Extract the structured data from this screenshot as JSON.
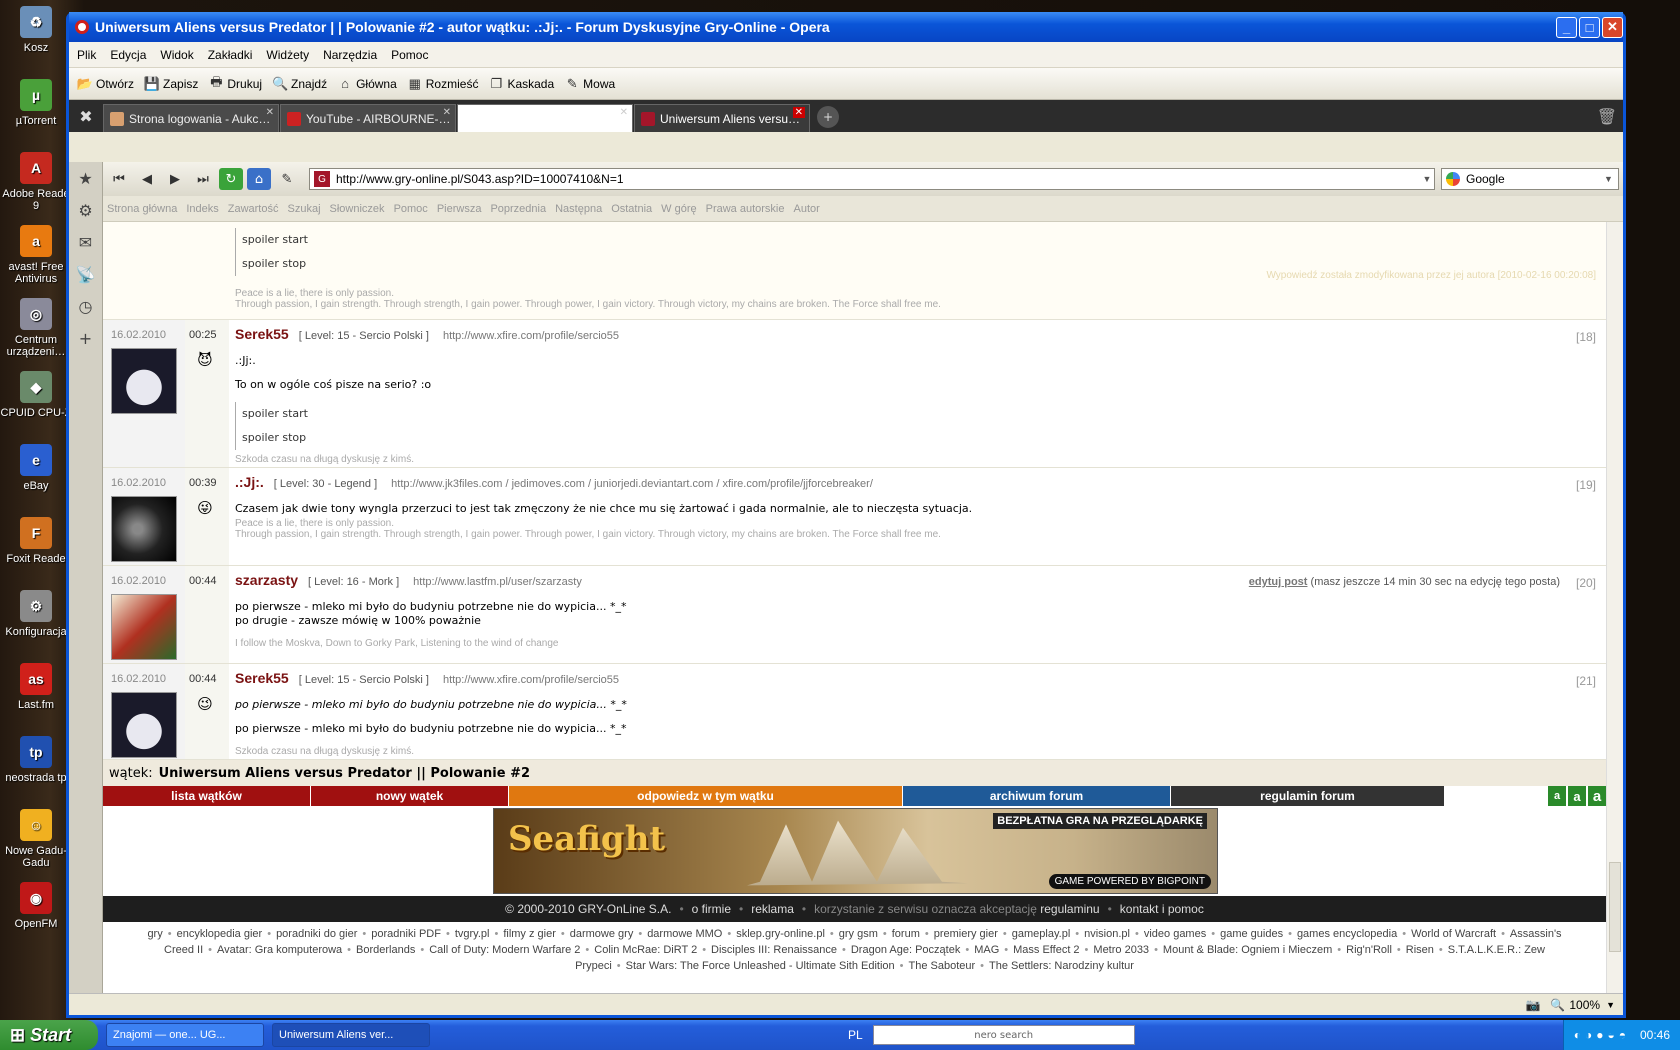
{
  "desktop": {
    "icons": [
      {
        "label": "Kosz",
        "color": "#6a8fb8",
        "glyph": "♻"
      },
      {
        "label": "µTorrent",
        "color": "#4aa03a",
        "glyph": "µ"
      },
      {
        "label": "Adobe Reade 9",
        "color": "#c5291f",
        "glyph": "A"
      },
      {
        "label": "avast! Free Antivirus",
        "color": "#e87a10",
        "glyph": "a"
      },
      {
        "label": "Centrum urządzeni…",
        "color": "#8a8a9a",
        "glyph": "◎"
      },
      {
        "label": "CPUID CPU-Z",
        "color": "#6a8a6a",
        "glyph": "◆"
      },
      {
        "label": "eBay",
        "color": "#2a5fd0",
        "glyph": "e"
      },
      {
        "label": "Foxit Reade",
        "color": "#d07020",
        "glyph": "F"
      },
      {
        "label": "Konfiguracja",
        "color": "#8a8a8a",
        "glyph": "⚙"
      },
      {
        "label": "Last.fm",
        "color": "#d0201a",
        "glyph": "as"
      },
      {
        "label": "neostrada tp",
        "color": "#2050b0",
        "glyph": "tp"
      },
      {
        "label": "Nowe Gadu-Gadu",
        "color": "#f0b020",
        "glyph": "☺"
      },
      {
        "label": "OpenFM",
        "color": "#c01818",
        "glyph": "◉"
      }
    ]
  },
  "window": {
    "title": "Uniwersum Aliens versus Predator | | Polowanie #2 - autor wątku: .:Jj:. - Forum Dyskusyjne Gry-Online - Opera"
  },
  "menu": [
    "Plik",
    "Edycja",
    "Widok",
    "Zakładki",
    "Widżety",
    "Narzędzia",
    "Pomoc"
  ],
  "toolbar": [
    {
      "label": "Otwórz",
      "icon": "folder-icon",
      "glyph": "📂"
    },
    {
      "label": "Zapisz",
      "icon": "save-icon",
      "glyph": "💾"
    },
    {
      "label": "Drukuj",
      "icon": "print-icon",
      "glyph": "🖶"
    },
    {
      "label": "Znajdź",
      "icon": "find-icon",
      "glyph": "🔍"
    },
    {
      "label": "Główna",
      "icon": "home-icon",
      "glyph": "⌂"
    },
    {
      "label": "Rozmieść",
      "icon": "tile-icon",
      "glyph": "▦"
    },
    {
      "label": "Kaskada",
      "icon": "cascade-icon",
      "glyph": "❐"
    },
    {
      "label": "Mowa",
      "icon": "speech-icon",
      "glyph": "✎"
    }
  ],
  "tabs": [
    {
      "label": "Strona logowania - Aukc…",
      "fav": "#d8a070",
      "blank": false,
      "active": false
    },
    {
      "label": "YouTube - AIRBOURNE-…",
      "fav": "#cc2222",
      "blank": false,
      "active": false
    },
    {
      "label": "",
      "fav": "#ffffff",
      "blank": true,
      "active": false
    },
    {
      "label": "Uniwersum Aliens versu…",
      "fav": "#a3162a",
      "blank": false,
      "active": true
    }
  ],
  "address": {
    "url": "http://www.gry-online.pl/S043.asp?ID=10007410&N=1",
    "search_engine": "Google"
  },
  "navlinks": [
    "Strona główna",
    "Indeks",
    "Zawartość",
    "Szukaj",
    "Słowniczek",
    "Pomoc",
    "Pierwsza",
    "Poprzednia",
    "Następna",
    "Ostatnia",
    "W górę",
    "Prawa autorskie",
    "Autor"
  ],
  "post_top": {
    "spoiler_start": "spoiler start",
    "spoiler_stop": "spoiler stop",
    "edited_note": "Wypowiedź została zmodyfikowana przez jej autora [2010-02-16 00:20:08]",
    "sig1": "Peace is a lie, there is only passion.",
    "sig2": "Through passion, I gain strength. Through strength, I gain power. Through power, I gain victory. Through victory, my chains are broken. The Force shall free me."
  },
  "posts": [
    {
      "date": "16.02.2010",
      "time": "00:25",
      "nick": "Serek55",
      "level": "[ Level: 15 - Sercio Polski ]",
      "www": "http://www.xfire.com/profile/sercio55",
      "num": "[18]",
      "emoticon": "😈",
      "lines": [
        ".:Jj:.",
        "To on w ogóle coś pisze na serio? :o"
      ],
      "spoiler": true,
      "spoiler_start": "spoiler start",
      "spoiler_stop": "spoiler stop",
      "sig": [
        "Szkoda czasu na długą dyskusję z kimś."
      ]
    },
    {
      "date": "16.02.2010",
      "time": "00:39",
      "nick": ".:Jj:.",
      "level": "[ Level: 30 - Legend ]",
      "www": "http://www.jk3files.com / jedimoves.com / juniorjedi.deviantart.com / xfire.com/profile/jjforcebreaker/",
      "num": "[19]",
      "emoticon": "😜",
      "lines": [
        "Czasem jak dwie tony wyngla przerzuci to jest tak zmęczony że nie chce mu się żartować i gada normalnie, ale to nieczęsta sytuacja."
      ],
      "spoiler": false,
      "sig": [
        "Peace is a lie, there is only passion.",
        "Through passion, I gain strength. Through strength, I gain power. Through power, I gain victory. Through victory, my chains are broken. The Force shall free me."
      ]
    },
    {
      "date": "16.02.2010",
      "time": "00:44",
      "nick": "szarzasty",
      "level": "[ Level: 16 - Mork ]",
      "www": "http://www.lastfm.pl/user/szarzasty",
      "num": "[20]",
      "emoticon": "",
      "edit_link": "edytuj post",
      "edit_note": "(masz jeszcze 14 min 30 sec na edycję tego posta)",
      "lines": [
        "po pierwsze - mleko mi było do budyniu potrzebne nie do wypicia... *_*",
        "po drugie - zawsze mówię w 100% poważnie"
      ],
      "spoiler": false,
      "sig": [
        "I follow the Moskva, Down to Gorky Park, Listening to the wind of change"
      ]
    },
    {
      "date": "16.02.2010",
      "time": "00:44",
      "nick": "Serek55",
      "level": "[ Level: 15 - Sercio Polski ]",
      "www": "http://www.xfire.com/profile/sercio55",
      "num": "[21]",
      "emoticon": "😉",
      "quote": "po pierwsze - mleko mi było do budyniu potrzebne nie do wypicia... *_*",
      "lines": [
        "po pierwsze - mleko mi było do budyniu potrzebne nie do wypicia... *_*"
      ],
      "spoiler": false,
      "sig": [
        "Szkoda czasu na długą dyskusję z kimś."
      ]
    }
  ],
  "thread": {
    "prefix": "wątek:",
    "title": "Uniwersum Aliens versus Predator || Polowanie #2"
  },
  "forumbar": [
    {
      "label": "lista wątków",
      "color": "#a01010",
      "w": 208
    },
    {
      "label": "nowy wątek",
      "color": "#a01010",
      "w": 198
    },
    {
      "label": "odpowiedz w tym wątku",
      "color": "#e07810",
      "w": 394
    },
    {
      "label": "archiwum forum",
      "color": "#1f5a98",
      "w": 268
    },
    {
      "label": "regulamin forum",
      "color": "#333333",
      "w": 274
    }
  ],
  "fontsizes": [
    "a",
    "a",
    "a"
  ],
  "banner": {
    "logo": "Seafight",
    "tag": "BEZPŁATNA GRA NA PRZEGLĄDARKĘ",
    "powered": "GAME POWERED BY BIGPOINT"
  },
  "copy": {
    "owner": "© 2000-2010 GRY-OnLine S.A.",
    "firm": "o firmie",
    "ads": "reklama",
    "accept": "korzystanie z serwisu oznacza akceptację",
    "rules": "regulaminu",
    "contact": "kontakt i pomoc"
  },
  "footer_links": [
    "gry",
    "encyklopedia gier",
    "poradniki do gier",
    "poradniki PDF",
    "tvgry.pl",
    "filmy z gier",
    "darmowe gry",
    "darmowe MMO",
    "sklep.gry-online.pl",
    "gry gsm",
    "forum",
    "premiery gier",
    "gameplay.pl",
    "nvision.pl",
    "video games",
    "game guides",
    "games encyclopedia",
    "World of Warcraft",
    "Assassin's Creed II",
    "Avatar: Gra komputerowa",
    "Borderlands",
    "Call of Duty: Modern Warfare 2",
    "Colin McRae: DiRT 2",
    "Disciples III: Renaissance",
    "Dragon Age: Początek",
    "MAG",
    "Mass Effect 2",
    "Metro 2033",
    "Mount & Blade: Ogniem i Mieczem",
    "Rig'n'Roll",
    "Risen",
    "S.T.A.L.K.E.R.: Zew Prypeci",
    "Star Wars: The Force Unleashed - Ultimate Sith Edition",
    "The Saboteur",
    "The Settlers: Narodziny kultur"
  ],
  "status": {
    "zoom": "100%"
  },
  "taskbar": {
    "start": "Start",
    "buttons": [
      {
        "label": "Znajomi — one... UG...",
        "active": false
      },
      {
        "label": "Uniwersum Aliens ver...",
        "active": true
      }
    ],
    "lang": "PL",
    "search": "nero search",
    "clock": "00:46"
  }
}
